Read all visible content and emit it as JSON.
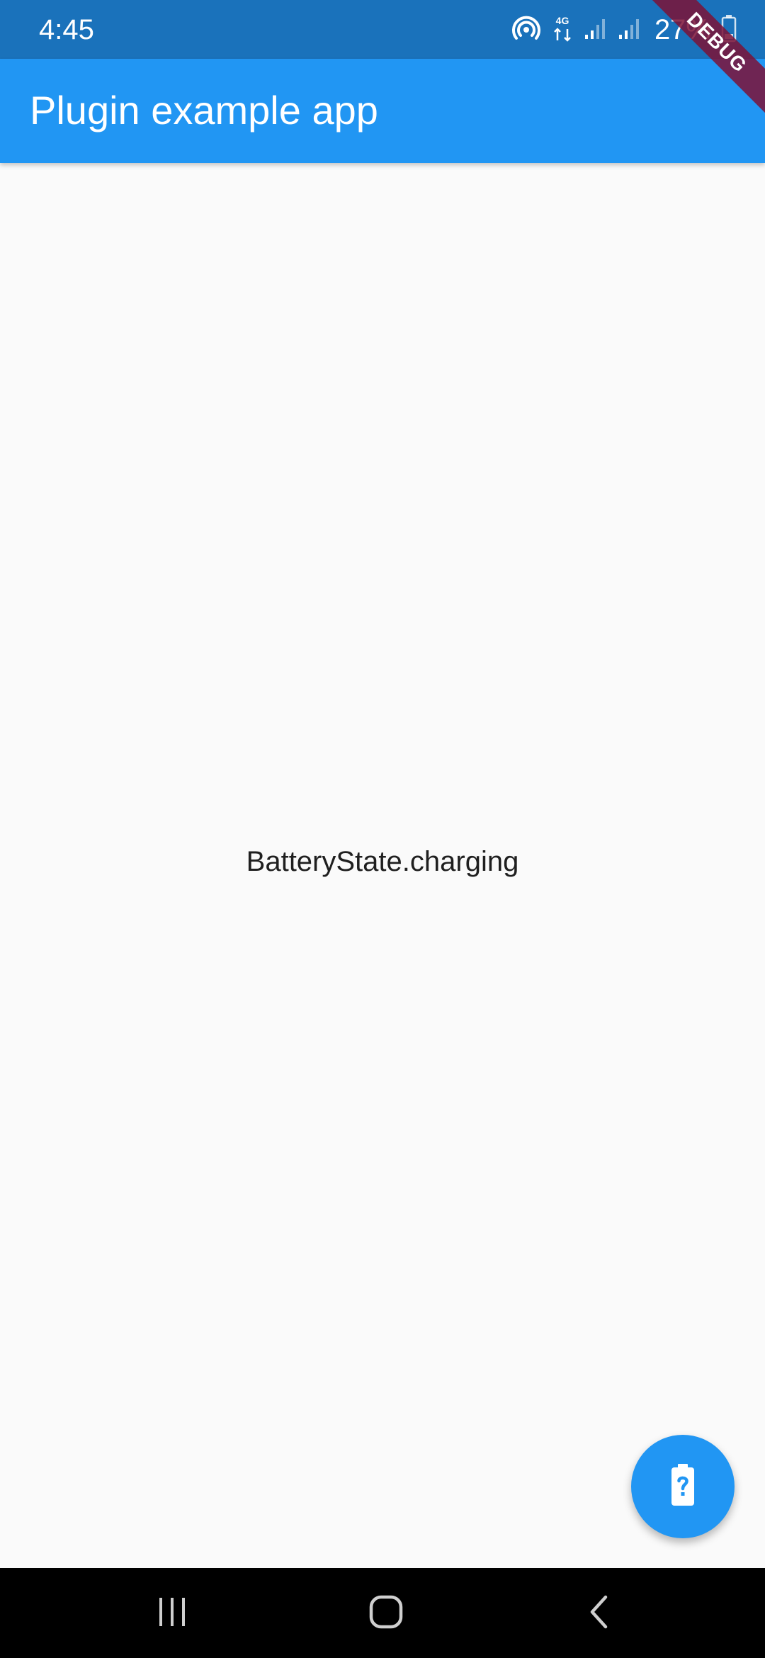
{
  "status_bar": {
    "time": "4:45",
    "battery_percent": "27%",
    "network_type": "4G",
    "icons": [
      "hotspot-icon",
      "data-transfer-icon",
      "signal-icon",
      "signal-icon",
      "battery-icon"
    ]
  },
  "app_bar": {
    "title": "Plugin example app"
  },
  "debug_banner": {
    "label": "DEBUG"
  },
  "content": {
    "battery_state": "BatteryState.charging"
  },
  "fab": {
    "icon": "battery-unknown-icon"
  },
  "nav_bar": {
    "buttons": [
      "recents-icon",
      "home-icon",
      "back-icon"
    ]
  },
  "colors": {
    "status_bar": "#1a72bb",
    "app_bar": "#2196f3",
    "background": "#fafafa",
    "fab": "#2196f3",
    "debug_banner": "#7d1236",
    "nav_bar": "#000000"
  }
}
